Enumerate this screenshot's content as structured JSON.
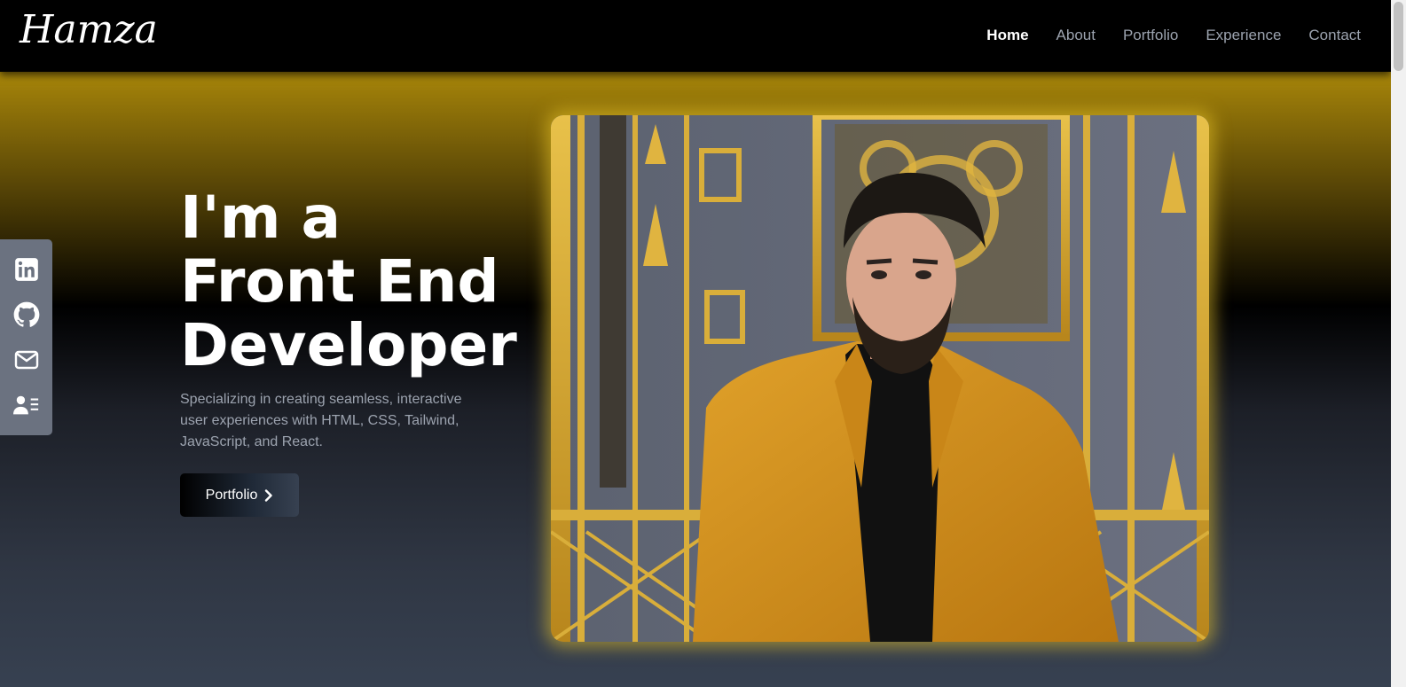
{
  "brand": {
    "name": "Hamza"
  },
  "nav": {
    "items": [
      {
        "label": "Home",
        "active": true
      },
      {
        "label": "About",
        "active": false
      },
      {
        "label": "Portfolio",
        "active": false
      },
      {
        "label": "Experience",
        "active": false
      },
      {
        "label": "Contact",
        "active": false
      }
    ]
  },
  "social": {
    "icons": [
      "linkedin-icon",
      "github-icon",
      "mail-icon",
      "resume-icon"
    ]
  },
  "hero": {
    "headline_lines": [
      "I'm a",
      "Front End",
      "Developer"
    ],
    "tagline": "Specializing in creating seamless, interactive user experiences with HTML, CSS, Tailwind, JavaScript, and React.",
    "cta_label": "Portfolio"
  },
  "colors": {
    "accent_gold": "#a8860a",
    "nav_bg": "#000000",
    "text_muted": "#9ca3af",
    "social_bg": "#6b7280",
    "photo_glow": "#eac428"
  }
}
